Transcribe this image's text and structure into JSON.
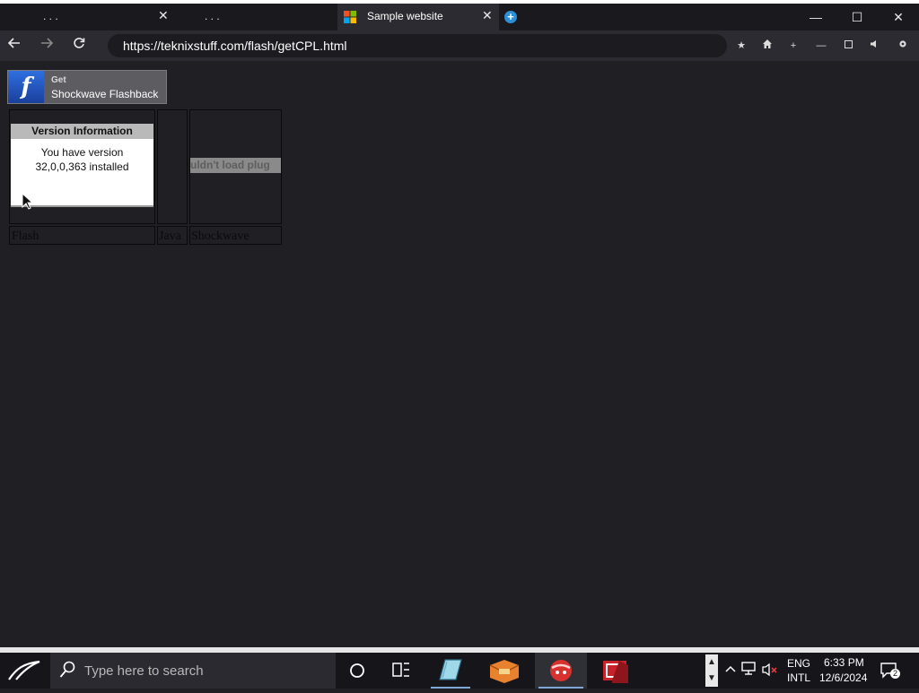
{
  "browser": {
    "tabs": [
      {
        "title": ". . .",
        "close": "✕"
      },
      {
        "title": ". . ."
      },
      {
        "title": "Sample website",
        "close": "✕",
        "active": true
      }
    ],
    "new_tab_label": "+",
    "window_controls": {
      "minimize": "—",
      "maximize": "☐",
      "close": "✕"
    },
    "url": "https://teknixstuff.com/flash/getCPL.html"
  },
  "page": {
    "banner": {
      "get": "Get",
      "name": "Shockwave Flashback",
      "logo_glyph": "f"
    },
    "version_info": {
      "heading": "Version Information",
      "line1": "You have version",
      "line2": "32,0,0,363 installed"
    },
    "plugin_error": "uldn't load plug",
    "captions": {
      "flash": "Flash",
      "java": "Java",
      "shockwave": "Shockwave"
    }
  },
  "taskbar": {
    "search_placeholder": "Type here to search",
    "language": {
      "line1": "ENG",
      "line2": "INTL"
    },
    "clock": {
      "time": "6:33 PM",
      "date": "12/6/2024"
    },
    "notification_count": "2"
  },
  "colors": {
    "page_bg": "#201f24",
    "accent_blue": "#2d8fd6"
  }
}
